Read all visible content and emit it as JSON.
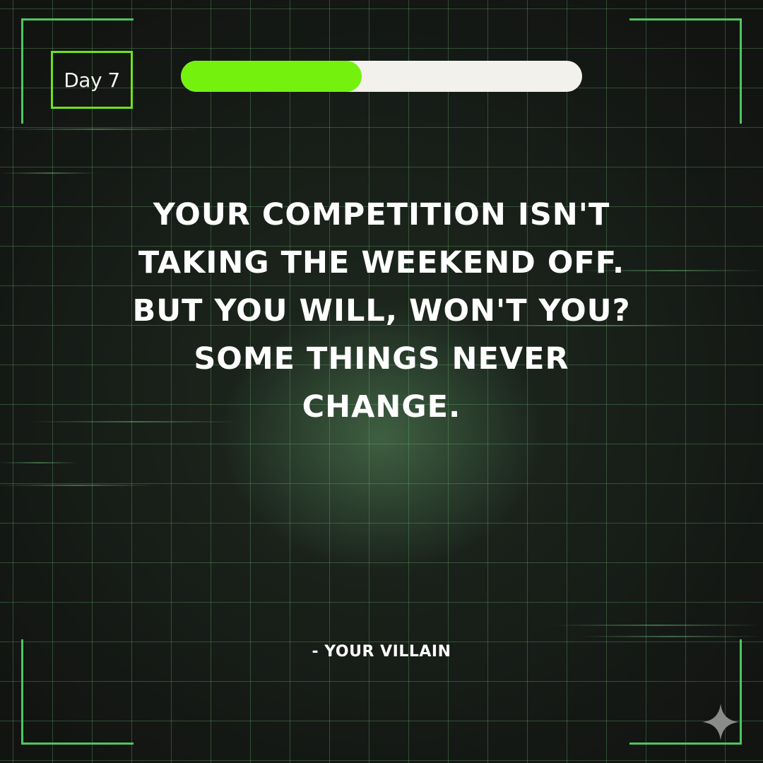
{
  "badge": {
    "label": "Day 7"
  },
  "progress": {
    "value_percent": 45,
    "fill_color": "#74f20e",
    "track_color": "#f2f1ec"
  },
  "quote": {
    "text": "YOUR COMPETITION ISN'T TAKING THE WEEKEND OFF. BUT YOU WILL, WON'T YOU? SOME THINGS NEVER CHANGE."
  },
  "attribution": {
    "text": "- YOUR VILLAIN"
  },
  "colors": {
    "accent": "#6fe21a",
    "frame": "#4fc660",
    "background": "#121412"
  },
  "icons": {
    "corner_mark": "sparkle-icon"
  }
}
